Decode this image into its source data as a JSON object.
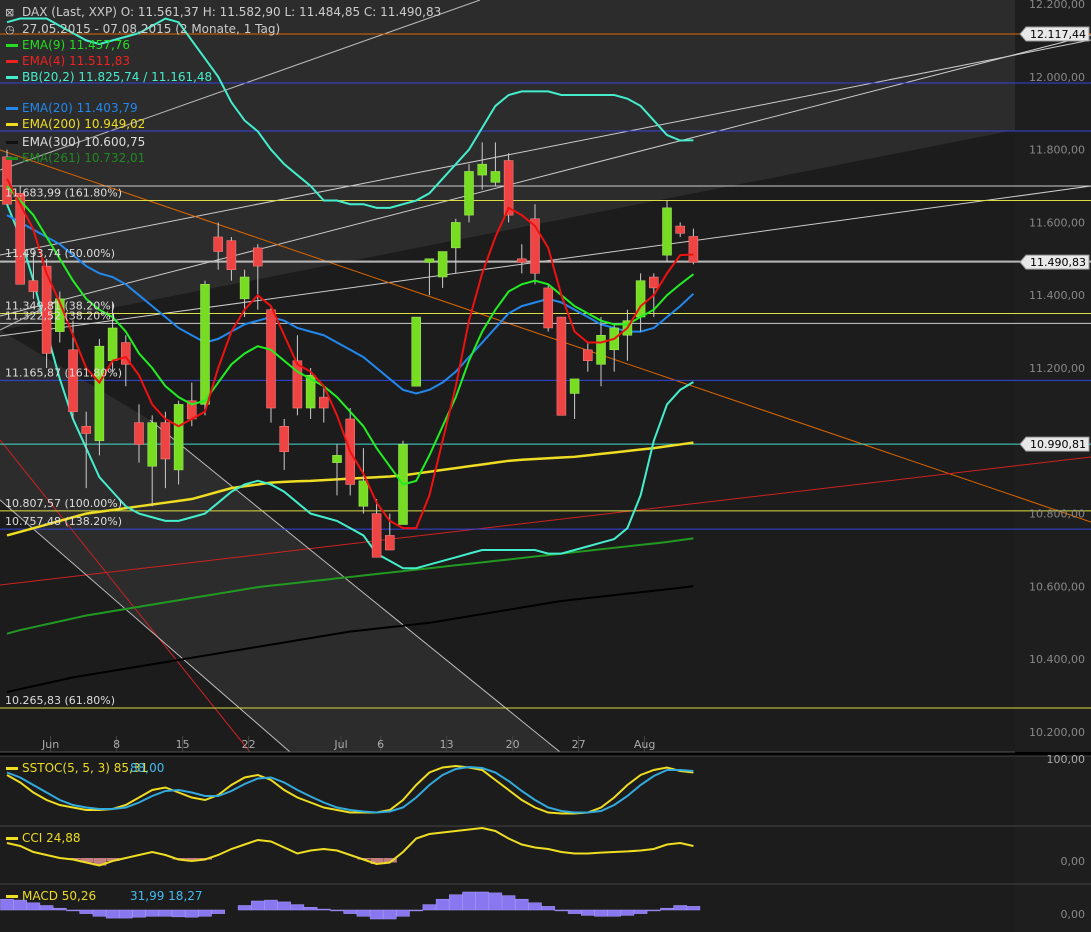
{
  "header": {
    "symbol": "DAX (Last, XXP)",
    "ohlc": "O: 11.561,37  H: 11.582,90  L: 11.484,85  C: 11.490,83",
    "range": "27.05.2015 - 07.08.2015 (2 Monate, 1 Tag)"
  },
  "legend": [
    {
      "label": "EMA(9)",
      "value": "11.457,76",
      "color": "#22dd22"
    },
    {
      "label": "EMA(4)",
      "value": "11.511,83",
      "color": "#ee2222"
    },
    {
      "label": "BB(20,2)",
      "value": "11.825,74 / 11.161,48",
      "color": "#44eecc"
    },
    {
      "label": "EMA(20)",
      "value": "11.403,79",
      "color": "#2288ee"
    },
    {
      "label": "EMA(200)",
      "value": "10.949,02",
      "color": "#eedd22"
    },
    {
      "label": "EMA(300)",
      "value": "10.600,75",
      "color": "#111111"
    },
    {
      "label": "EMA(261)",
      "value": "10.732,01",
      "color": "#228822"
    }
  ],
  "price_labels": [
    {
      "text": "12.117,44",
      "price": 12117.44,
      "line": "#dd6600"
    },
    {
      "text": "11.490,83",
      "price": 11490.83,
      "line": "#bbbbbb"
    },
    {
      "text": "10.990,81",
      "price": 10990.81,
      "line": "#44ddcc"
    }
  ],
  "fib_levels": [
    {
      "text": "11.683,99 (161.80%)",
      "price": 11660.0,
      "color": "#dddd44"
    },
    {
      "text": "11.493,74 (50.00%)",
      "price": 11493.74,
      "color": "#cccccc"
    },
    {
      "text": "11.349,81 (38.20%)",
      "price": 11349.81,
      "color": "#dddd44"
    },
    {
      "text": "11.322,52 (38.20%)",
      "price": 11322.52,
      "color": "#cccccc"
    },
    {
      "text": "11.165,87 (161.80%)",
      "price": 11165.87,
      "color": "#3344dd"
    },
    {
      "text": "10.807,57 (100.00%)",
      "price": 10807.57,
      "color": "#dddd44"
    },
    {
      "text": "10.757,48 (138.20%)",
      "price": 10757.48,
      "color": "#3344dd"
    },
    {
      "text": "10.265,83 (61.80%)",
      "price": 10265.83,
      "color": "#dddd44"
    }
  ],
  "axis_labels": {
    "price": [
      "12.200,00",
      "12.000,00",
      "11.800,00",
      "11.600,00",
      "11.400,00",
      "11.200,00",
      "11.000,00",
      "10.800,00",
      "10.600,00",
      "10.400,00",
      "10.200,00"
    ],
    "dates": [
      "Jun",
      "8",
      "15",
      "22",
      "Jul",
      "6",
      "13",
      "20",
      "27",
      "Aug"
    ],
    "sstoc_right": "100,00",
    "cci_right": "0,00",
    "macd_right": "0,00"
  },
  "subpanels": {
    "sstoc": {
      "label": "SSTOC(5, 5, 3)",
      "v1": "85,31",
      "v2": "88,00"
    },
    "cci": {
      "label": "CCI",
      "v1": "24,88"
    },
    "macd": {
      "label": "MACD",
      "v1": "50,26",
      "v2": "31,99",
      "v3": "18,27"
    }
  },
  "chart_data": {
    "type": "candlestick",
    "title": "DAX (Last, XXP)",
    "ylim": [
      10100,
      12250
    ],
    "candles": [
      {
        "o": 11780,
        "h": 11800,
        "l": 11650,
        "c": 11650
      },
      {
        "o": 11680,
        "h": 11700,
        "l": 11470,
        "c": 11430
      },
      {
        "o": 11440,
        "h": 11520,
        "l": 11390,
        "c": 11410
      },
      {
        "o": 11480,
        "h": 11500,
        "l": 11200,
        "c": 11240
      },
      {
        "o": 11300,
        "h": 11410,
        "l": 11270,
        "c": 11390
      },
      {
        "o": 11250,
        "h": 11330,
        "l": 11060,
        "c": 11080
      },
      {
        "o": 11040,
        "h": 11080,
        "l": 10870,
        "c": 11020
      },
      {
        "o": 11000,
        "h": 11280,
        "l": 10960,
        "c": 11260
      },
      {
        "o": 11220,
        "h": 11380,
        "l": 11190,
        "c": 11310
      },
      {
        "o": 11270,
        "h": 11290,
        "l": 11150,
        "c": 11210
      },
      {
        "o": 11050,
        "h": 11100,
        "l": 10940,
        "c": 10990
      },
      {
        "o": 10930,
        "h": 11070,
        "l": 10820,
        "c": 11050
      },
      {
        "o": 11050,
        "h": 11080,
        "l": 10870,
        "c": 10950
      },
      {
        "o": 10920,
        "h": 11110,
        "l": 10880,
        "c": 11100
      },
      {
        "o": 11110,
        "h": 11160,
        "l": 11040,
        "c": 11060
      },
      {
        "o": 11100,
        "h": 11440,
        "l": 11070,
        "c": 11430
      },
      {
        "o": 11560,
        "h": 11600,
        "l": 11470,
        "c": 11520
      },
      {
        "o": 11550,
        "h": 11560,
        "l": 11440,
        "c": 11470
      },
      {
        "o": 11390,
        "h": 11470,
        "l": 11340,
        "c": 11450
      },
      {
        "o": 11530,
        "h": 11540,
        "l": 11360,
        "c": 11480
      },
      {
        "o": 11360,
        "h": 11370,
        "l": 11050,
        "c": 11090
      },
      {
        "o": 11040,
        "h": 11060,
        "l": 10920,
        "c": 10970
      },
      {
        "o": 11220,
        "h": 11290,
        "l": 11070,
        "c": 11090
      },
      {
        "o": 11090,
        "h": 11200,
        "l": 11060,
        "c": 11180
      },
      {
        "o": 11120,
        "h": 11150,
        "l": 11050,
        "c": 11090
      },
      {
        "o": 10940,
        "h": 10990,
        "l": 10850,
        "c": 10960
      },
      {
        "o": 11060,
        "h": 11090,
        "l": 10850,
        "c": 10880
      },
      {
        "o": 10820,
        "h": 10980,
        "l": 10800,
        "c": 10890
      },
      {
        "o": 10800,
        "h": 10840,
        "l": 10680,
        "c": 10680
      },
      {
        "o": 10740,
        "h": 10800,
        "l": 10700,
        "c": 10700
      },
      {
        "o": 10770,
        "h": 11000,
        "l": 10770,
        "c": 10990
      },
      {
        "o": 11150,
        "h": 11340,
        "l": 11150,
        "c": 11340
      },
      {
        "o": 11490,
        "h": 11500,
        "l": 11400,
        "c": 11500
      },
      {
        "o": 11450,
        "h": 11520,
        "l": 11420,
        "c": 11520
      },
      {
        "o": 11530,
        "h": 11610,
        "l": 11460,
        "c": 11600
      },
      {
        "o": 11620,
        "h": 11760,
        "l": 11600,
        "c": 11740
      },
      {
        "o": 11730,
        "h": 11820,
        "l": 11690,
        "c": 11760
      },
      {
        "o": 11710,
        "h": 11820,
        "l": 11700,
        "c": 11740
      },
      {
        "o": 11770,
        "h": 11790,
        "l": 11600,
        "c": 11620
      },
      {
        "o": 11500,
        "h": 11540,
        "l": 11460,
        "c": 11490
      },
      {
        "o": 11610,
        "h": 11650,
        "l": 11430,
        "c": 11460
      },
      {
        "o": 11420,
        "h": 11430,
        "l": 11300,
        "c": 11310
      },
      {
        "o": 11340,
        "h": 11340,
        "l": 11070,
        "c": 11070
      },
      {
        "o": 11130,
        "h": 11170,
        "l": 11060,
        "c": 11170
      },
      {
        "o": 11250,
        "h": 11270,
        "l": 11190,
        "c": 11220
      },
      {
        "o": 11210,
        "h": 11340,
        "l": 11150,
        "c": 11290
      },
      {
        "o": 11250,
        "h": 11320,
        "l": 11190,
        "c": 11310
      },
      {
        "o": 11290,
        "h": 11360,
        "l": 11220,
        "c": 11330
      },
      {
        "o": 11340,
        "h": 11460,
        "l": 11300,
        "c": 11440
      },
      {
        "o": 11450,
        "h": 11460,
        "l": 11340,
        "c": 11420
      },
      {
        "o": 11510,
        "h": 11660,
        "l": 11490,
        "c": 11640
      },
      {
        "o": 11590,
        "h": 11600,
        "l": 11560,
        "c": 11570
      },
      {
        "o": 11561.37,
        "h": 11582.9,
        "l": 11484.85,
        "c": 11490.83
      }
    ],
    "ema9": [
      11700,
      11660,
      11620,
      11560,
      11500,
      11440,
      11390,
      11360,
      11340,
      11300,
      11240,
      11200,
      11150,
      11120,
      11100,
      11110,
      11160,
      11210,
      11240,
      11260,
      11250,
      11220,
      11190,
      11170,
      11150,
      11120,
      11080,
      11040,
      10980,
      10930,
      10880,
      10890,
      10960,
      11040,
      11120,
      11220,
      11300,
      11360,
      11410,
      11430,
      11440,
      11430,
      11400,
      11370,
      11350,
      11330,
      11320,
      11320,
      11340,
      11360,
      11400,
      11430,
      11457.76
    ],
    "ema4": [
      11720,
      11650,
      11580,
      11460,
      11380,
      11290,
      11200,
      11160,
      11220,
      11230,
      11180,
      11100,
      11060,
      11040,
      11060,
      11080,
      11200,
      11300,
      11360,
      11400,
      11370,
      11290,
      11210,
      11190,
      11150,
      11070,
      10970,
      10910,
      10830,
      10780,
      10760,
      10760,
      10850,
      11000,
      11150,
      11330,
      11460,
      11560,
      11640,
      11620,
      11590,
      11530,
      11400,
      11300,
      11270,
      11270,
      11280,
      11310,
      11370,
      11400,
      11460,
      11510,
      11511.83
    ],
    "ema20": [
      11620,
      11600,
      11580,
      11560,
      11540,
      11510,
      11480,
      11460,
      11450,
      11430,
      11400,
      11370,
      11340,
      11310,
      11290,
      11270,
      11280,
      11300,
      11320,
      11330,
      11340,
      11330,
      11310,
      11300,
      11290,
      11270,
      11250,
      11230,
      11200,
      11170,
      11140,
      11130,
      11140,
      11160,
      11190,
      11230,
      11270,
      11310,
      11350,
      11370,
      11380,
      11390,
      11380,
      11360,
      11340,
      11320,
      11310,
      11300,
      11300,
      11310,
      11340,
      11370,
      11403.79
    ],
    "ema200": [
      10740,
      10750,
      10760,
      10770,
      10780,
      10790,
      10800,
      10805,
      10810,
      10815,
      10820,
      10825,
      10830,
      10835,
      10840,
      10850,
      10860,
      10870,
      10875,
      10880,
      10885,
      10887,
      10889,
      10890,
      10892,
      10894,
      10896,
      10898,
      10900,
      10902,
      10905,
      10910,
      10915,
      10920,
      10925,
      10930,
      10935,
      10940,
      10945,
      10948,
      10950,
      10952,
      10954,
      10956,
      10960,
      10964,
      10968,
      10972,
      10976,
      10980,
      10985,
      10990,
      10995
    ],
    "ema261": [
      10470,
      10480,
      10488,
      10496,
      10504,
      10512,
      10520,
      10526,
      10532,
      10538,
      10544,
      10550,
      10556,
      10562,
      10568,
      10574,
      10580,
      10586,
      10592,
      10598,
      10602,
      10606,
      10610,
      10614,
      10618,
      10622,
      10626,
      10630,
      10634,
      10638,
      10642,
      10646,
      10650,
      10654,
      10658,
      10662,
      10666,
      10670,
      10674,
      10678,
      10682,
      10686,
      10690,
      10694,
      10698,
      10702,
      10706,
      10710,
      10714,
      10718,
      10722,
      10727,
      10732
    ],
    "ema300": [
      10310,
      10318,
      10326,
      10334,
      10342,
      10350,
      10356,
      10362,
      10368,
      10374,
      10380,
      10386,
      10392,
      10398,
      10404,
      10410,
      10416,
      10422,
      10428,
      10434,
      10440,
      10446,
      10452,
      10458,
      10464,
      10470,
      10476,
      10480,
      10484,
      10488,
      10492,
      10496,
      10500,
      10506,
      10512,
      10518,
      10524,
      10530,
      10536,
      10542,
      10548,
      10554,
      10560,
      10564,
      10568,
      10572,
      10576,
      10580,
      10584,
      10588,
      10592,
      10596,
      10600.75
    ],
    "bb_upper": [
      12150,
      12160,
      12160,
      12160,
      12140,
      12120,
      12100,
      12090,
      12100,
      12110,
      12120,
      12140,
      12160,
      12150,
      12100,
      12050,
      12000,
      11930,
      11880,
      11850,
      11800,
      11760,
      11730,
      11700,
      11660,
      11660,
      11650,
      11650,
      11640,
      11640,
      11650,
      11660,
      11680,
      11720,
      11760,
      11800,
      11860,
      11920,
      11950,
      11960,
      11960,
      11960,
      11950,
      11950,
      11950,
      11950,
      11950,
      11940,
      11920,
      11880,
      11840,
      11825,
      11825.74
    ],
    "bb_lower": [
      11650,
      11560,
      11440,
      11300,
      11170,
      11060,
      10980,
      10900,
      10860,
      10820,
      10800,
      10790,
      10780,
      10780,
      10790,
      10800,
      10830,
      10860,
      10880,
      10890,
      10880,
      10860,
      10830,
      10800,
      10790,
      10780,
      10760,
      10740,
      10690,
      10670,
      10650,
      10650,
      10660,
      10670,
      10680,
      10690,
      10700,
      10700,
      10700,
      10700,
      10700,
      10690,
      10690,
      10700,
      10710,
      10720,
      10730,
      10760,
      10850,
      11000,
      11100,
      11140,
      11161.48
    ],
    "sstoc_k": [
      0.8,
      0.65,
      0.45,
      0.3,
      0.2,
      0.15,
      0.1,
      0.1,
      0.12,
      0.2,
      0.35,
      0.5,
      0.55,
      0.45,
      0.35,
      0.3,
      0.4,
      0.6,
      0.75,
      0.8,
      0.7,
      0.5,
      0.35,
      0.25,
      0.15,
      0.1,
      0.05,
      0.05,
      0.05,
      0.1,
      0.3,
      0.6,
      0.85,
      0.95,
      0.98,
      0.95,
      0.9,
      0.7,
      0.5,
      0.3,
      0.15,
      0.05,
      0.03,
      0.03,
      0.05,
      0.15,
      0.35,
      0.6,
      0.8,
      0.9,
      0.95,
      0.88,
      0.85
    ],
    "sstoc_d": [
      0.85,
      0.75,
      0.6,
      0.45,
      0.3,
      0.2,
      0.15,
      0.12,
      0.12,
      0.15,
      0.25,
      0.38,
      0.48,
      0.5,
      0.45,
      0.38,
      0.38,
      0.48,
      0.62,
      0.73,
      0.75,
      0.65,
      0.5,
      0.37,
      0.25,
      0.15,
      0.1,
      0.07,
      0.05,
      0.07,
      0.15,
      0.35,
      0.6,
      0.8,
      0.92,
      0.96,
      0.94,
      0.85,
      0.68,
      0.48,
      0.3,
      0.15,
      0.08,
      0.05,
      0.05,
      0.08,
      0.2,
      0.38,
      0.6,
      0.78,
      0.9,
      0.9,
      0.88
    ],
    "cci": [
      0.2,
      0.1,
      -0.1,
      -0.2,
      -0.3,
      -0.35,
      -0.45,
      -0.55,
      -0.4,
      -0.3,
      -0.2,
      -0.1,
      -0.2,
      -0.35,
      -0.4,
      -0.35,
      -0.2,
      0.0,
      0.15,
      0.3,
      0.25,
      0.05,
      -0.15,
      -0.05,
      0.0,
      -0.05,
      -0.2,
      -0.35,
      -0.5,
      -0.45,
      -0.1,
      0.35,
      0.5,
      0.55,
      0.6,
      0.65,
      0.7,
      0.6,
      0.35,
      0.15,
      0.05,
      0.0,
      -0.1,
      -0.15,
      -0.15,
      -0.12,
      -0.1,
      -0.08,
      -0.05,
      0.0,
      0.15,
      0.2,
      0.1
    ],
    "macd_hist": [
      0.6,
      0.55,
      0.4,
      0.25,
      0.1,
      -0.05,
      -0.2,
      -0.35,
      -0.45,
      -0.45,
      -0.4,
      -0.35,
      -0.35,
      -0.38,
      -0.4,
      -0.35,
      -0.2,
      0.0,
      0.25,
      0.5,
      0.55,
      0.45,
      0.3,
      0.15,
      0.05,
      -0.05,
      -0.2,
      -0.35,
      -0.5,
      -0.5,
      -0.35,
      -0.05,
      0.3,
      0.6,
      0.85,
      1.0,
      1.0,
      0.95,
      0.8,
      0.6,
      0.4,
      0.2,
      -0.05,
      -0.2,
      -0.3,
      -0.35,
      -0.35,
      -0.3,
      -0.2,
      -0.05,
      0.1,
      0.25,
      0.2
    ]
  }
}
